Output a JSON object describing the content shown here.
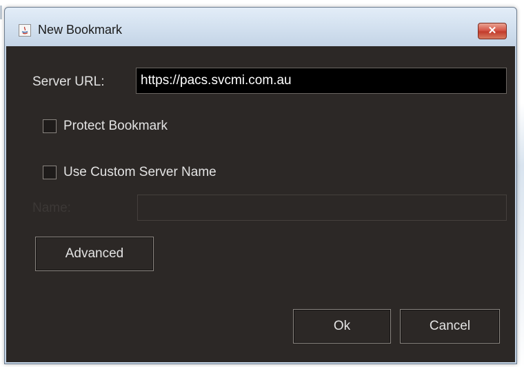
{
  "window": {
    "title": "New Bookmark",
    "close_label": "✕"
  },
  "form": {
    "server_url_label": "Server URL:",
    "server_url_value": "https://pacs.svcmi.com.au",
    "protect_label": "Protect Bookmark",
    "protect_checked": false,
    "custom_name_label": "Use Custom Server Name",
    "custom_name_checked": false,
    "name_label": "Name:",
    "name_value": ""
  },
  "buttons": {
    "advanced": "Advanced",
    "ok": "Ok",
    "cancel": "Cancel"
  },
  "colors": {
    "dialog_bg": "#2c2826",
    "input_bg": "#000000",
    "text": "#e3e3e3",
    "close_button": "#c84a3a"
  }
}
